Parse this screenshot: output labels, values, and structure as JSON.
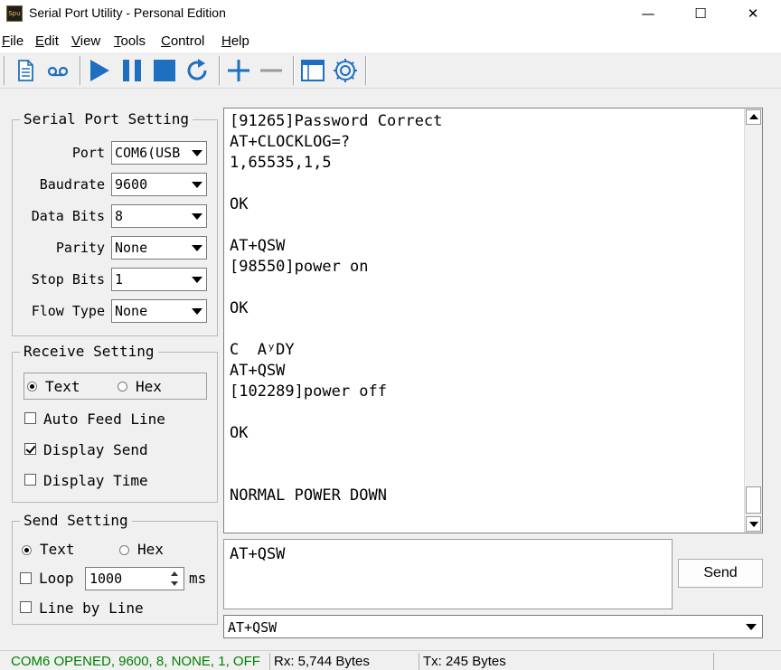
{
  "window": {
    "icon_text": "Spu",
    "title": "Serial Port Utility - Personal Edition",
    "minimize_glyph": "—",
    "maximize_glyph": "☐",
    "close_glyph": "✕"
  },
  "menu": [
    {
      "key": "F",
      "rest": "ile"
    },
    {
      "key": "E",
      "rest": "dit"
    },
    {
      "key": "V",
      "rest": "iew"
    },
    {
      "key": "T",
      "rest": "ools"
    },
    {
      "key": "C",
      "rest": "ontrol"
    },
    {
      "key": "H",
      "rest": "elp"
    }
  ],
  "toolbar": {
    "icons": [
      "document-icon",
      "cassette-icon",
      "play-icon",
      "pause-icon",
      "stop-icon",
      "refresh-icon",
      "plus-icon",
      "minus-icon",
      "window-icon",
      "gear-icon"
    ],
    "accent": "#1f6fc1"
  },
  "serial_setting": {
    "title": "Serial Port Setting",
    "fields": [
      {
        "label": "Port",
        "value": "COM6(USB"
      },
      {
        "label": "Baudrate",
        "value": "9600"
      },
      {
        "label": "Data Bits",
        "value": "8"
      },
      {
        "label": "Parity",
        "value": "None"
      },
      {
        "label": "Stop Bits",
        "value": "1"
      },
      {
        "label": "Flow Type",
        "value": "None"
      }
    ]
  },
  "receive_setting": {
    "title": "Receive Setting",
    "mode_text": "Text",
    "mode_hex": "Hex",
    "mode_selected": "Text",
    "auto_feed_line": "Auto Feed Line",
    "auto_feed_line_checked": false,
    "display_send": "Display Send",
    "display_send_checked": true,
    "display_time": "Display Time",
    "display_time_checked": false
  },
  "send_setting": {
    "title": "Send Setting",
    "mode_text": "Text",
    "mode_hex": "Hex",
    "mode_selected": "Text",
    "loop_label": "Loop",
    "loop_checked": false,
    "loop_interval": "1000",
    "loop_unit": "ms",
    "line_by_line": "Line by Line",
    "line_by_line_checked": false
  },
  "receive_area": {
    "lines": [
      "[91265]Password Correct",
      "AT+CLOCKLOG=?",
      "1,65535,1,5",
      "",
      "OK",
      "",
      "AT+QSW",
      "[98550]power on",
      "",
      "OK",
      "",
      "C  AʸDY",
      "AT+QSW",
      "[102289]power off",
      "",
      "OK",
      "",
      "",
      "NORMAL POWER DOWN"
    ]
  },
  "send_area": {
    "text": "AT+QSW",
    "send_button": "Send",
    "history_value": "AT+QSW"
  },
  "status": {
    "connection": "COM6 OPENED, 9600, 8, NONE, 1, OFF",
    "connection_color": "#008000",
    "rx": "Rx: 5,744 Bytes",
    "tx": "Tx: 245 Bytes"
  }
}
